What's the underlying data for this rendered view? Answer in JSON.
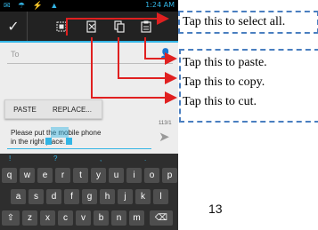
{
  "status_bar": {
    "time": "1:24 AM"
  },
  "action_bar": {
    "done_icon": "check-icon",
    "select_all_icon": "select-all-icon",
    "cut_icon": "cut-icon",
    "copy_icon": "copy-icon",
    "paste_icon": "paste-icon"
  },
  "recipient": {
    "placeholder": "To"
  },
  "popup": {
    "paste_label": "PASTE",
    "replace_label": "REPLACE..."
  },
  "compose": {
    "char_count": "113/1",
    "text_line1": "Please put the mobile phone",
    "text_line2": "in the right place."
  },
  "keyboard": {
    "suggestions": [
      "!",
      "?",
      ",",
      "."
    ],
    "row1": [
      "q",
      "w",
      "e",
      "r",
      "t",
      "y",
      "u",
      "i",
      "o",
      "p"
    ],
    "row2": [
      "a",
      "s",
      "d",
      "f",
      "g",
      "h",
      "j",
      "k",
      "l"
    ],
    "row3": [
      "z",
      "x",
      "c",
      "v",
      "b",
      "n",
      "m"
    ]
  },
  "callouts": {
    "select_all": "Tap this to select all.",
    "paste": "Tap this to paste.",
    "copy": "Tap this to copy.",
    "cut": "Tap this to cut."
  },
  "page_number": "13",
  "colors": {
    "accent": "#33b5e5",
    "arrow": "#e02020",
    "callout_border": "#4a7fc0"
  }
}
